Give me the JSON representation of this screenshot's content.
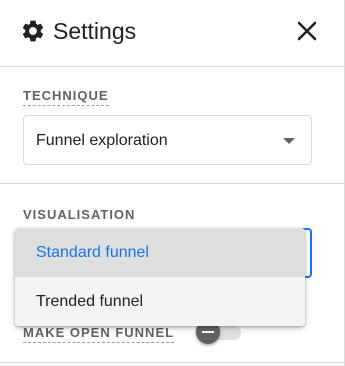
{
  "header": {
    "title": "Settings",
    "icon": "gear-icon",
    "close_icon": "close-icon"
  },
  "technique": {
    "label": "TECHNIQUE",
    "value": "Funnel exploration"
  },
  "visualisation": {
    "label": "VISUALISATION",
    "options": [
      {
        "label": "Standard funnel",
        "selected": true
      },
      {
        "label": "Trended funnel",
        "selected": false
      }
    ]
  },
  "open_funnel": {
    "label": "MAKE OPEN FUNNEL",
    "enabled": false
  },
  "colors": {
    "accent": "#1a73e8",
    "text": "#202124",
    "label": "#5f6368",
    "selected_bg": "#dedede"
  }
}
